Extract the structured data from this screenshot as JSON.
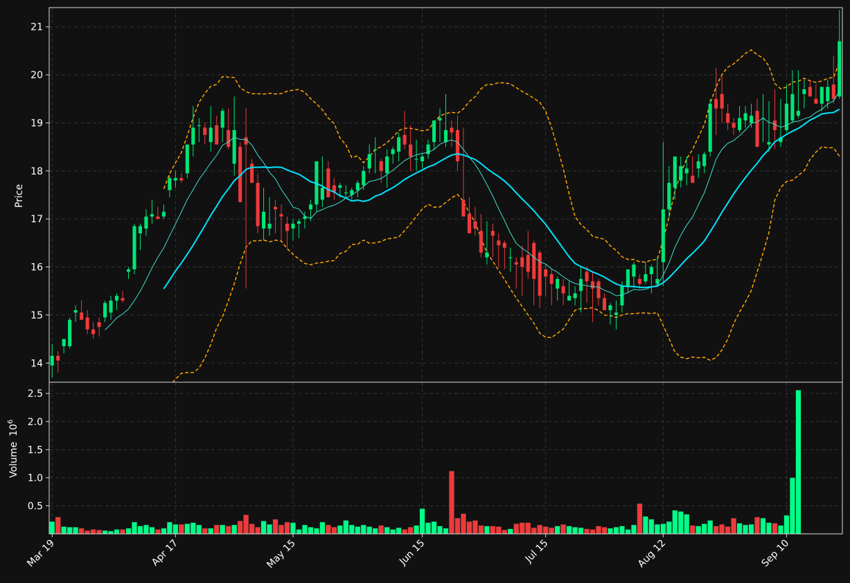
{
  "chart_data": [
    {
      "type": "candlestick",
      "panel": "price",
      "ylabel": "Price",
      "ylim": [
        13.6,
        21.4
      ],
      "yticks": [
        "14",
        "15",
        "16",
        "17",
        "18",
        "19",
        "20",
        "21"
      ],
      "ytick_values": [
        14,
        15,
        16,
        17,
        18,
        19,
        20,
        21
      ],
      "grid": true,
      "overlays": [
        {
          "style": "thin cyan line",
          "color": "#40e0d0",
          "description": "short moving average"
        },
        {
          "style": "thick cyan line",
          "color": "#00e5ff",
          "description": "long moving average"
        },
        {
          "style": "dashed orange lines",
          "color": "#ffa500",
          "description": "upper and lower bands"
        }
      ],
      "colors": {
        "up": "#00e676",
        "down": "#ef3a3a"
      },
      "x_dates": [
        "2024-03-19",
        "2024-03-20",
        "2024-03-21",
        "2024-03-22",
        "2024-03-25",
        "2024-03-26",
        "2024-03-27",
        "2024-03-28",
        "2024-03-29",
        "2024-04-01",
        "2024-04-02",
        "2024-04-03",
        "2024-04-04",
        "2024-04-05",
        "2024-04-08",
        "2024-04-09",
        "2024-04-10",
        "2024-04-11",
        "2024-04-12",
        "2024-04-15",
        "2024-04-16",
        "2024-04-17",
        "2024-04-18",
        "2024-04-19",
        "2024-04-22",
        "2024-04-23",
        "2024-04-24",
        "2024-04-25",
        "2024-04-26",
        "2024-04-29",
        "2024-04-30",
        "2024-05-01",
        "2024-05-02",
        "2024-05-03",
        "2024-05-06",
        "2024-05-07",
        "2024-05-08",
        "2024-05-09",
        "2024-05-10",
        "2024-05-13",
        "2024-05-14",
        "2024-05-15",
        "2024-05-16",
        "2024-05-17",
        "2024-05-20",
        "2024-05-21",
        "2024-05-22",
        "2024-05-23",
        "2024-05-24",
        "2024-05-27",
        "2024-05-28",
        "2024-05-29",
        "2024-05-30",
        "2024-05-31",
        "2024-06-03",
        "2024-06-04",
        "2024-06-05",
        "2024-06-06",
        "2024-06-07",
        "2024-06-10",
        "2024-06-11",
        "2024-06-12",
        "2024-06-13",
        "2024-06-14",
        "2024-06-17",
        "2024-06-18",
        "2024-06-19",
        "2024-06-20",
        "2024-06-21",
        "2024-06-24",
        "2024-06-25",
        "2024-06-26",
        "2024-06-27",
        "2024-06-28",
        "2024-07-01",
        "2024-07-02",
        "2024-07-03",
        "2024-07-04",
        "2024-07-05",
        "2024-07-08",
        "2024-07-09",
        "2024-07-10",
        "2024-07-11",
        "2024-07-12",
        "2024-07-15",
        "2024-07-16",
        "2024-07-17",
        "2024-07-18",
        "2024-07-19",
        "2024-07-22",
        "2024-07-23",
        "2024-07-24",
        "2024-07-25",
        "2024-07-26",
        "2024-07-29",
        "2024-07-30",
        "2024-07-31",
        "2024-08-01",
        "2024-08-02",
        "2024-08-05",
        "2024-08-06",
        "2024-08-07",
        "2024-08-08",
        "2024-08-09",
        "2024-08-12",
        "2024-08-13",
        "2024-08-14",
        "2024-08-15",
        "2024-08-16",
        "2024-08-19",
        "2024-08-20",
        "2024-08-21",
        "2024-08-22",
        "2024-08-23",
        "2024-08-26",
        "2024-08-27",
        "2024-08-28",
        "2024-08-29",
        "2024-08-30",
        "2024-09-02",
        "2024-09-03",
        "2024-09-04",
        "2024-09-05",
        "2024-09-06",
        "2024-09-09",
        "2024-09-10",
        "2024-09-11",
        "2024-09-12",
        "2024-09-13",
        "2024-09-16",
        "2024-09-17",
        "2024-09-18",
        "2024-09-19"
      ],
      "open": [
        13.95,
        14.15,
        14.35,
        14.35,
        15.05,
        15.05,
        14.95,
        14.7,
        14.85,
        14.95,
        15.05,
        15.3,
        15.35,
        15.9,
        15.95,
        16.7,
        16.8,
        17.05,
        17.05,
        17.05,
        17.6,
        17.8,
        17.85,
        17.95,
        18.55,
        18.95,
        18.9,
        18.6,
        18.95,
        18.9,
        18.85,
        18.15,
        18.5,
        18.7,
        18.15,
        17.75,
        16.8,
        16.8,
        17.25,
        17.1,
        16.9,
        16.8,
        16.9,
        17.0,
        17.2,
        17.3,
        17.4,
        18.05,
        17.7,
        17.65,
        17.55,
        17.5,
        17.6,
        17.7,
        18.05,
        18.45,
        18.2,
        17.95,
        18.35,
        18.4,
        18.75,
        18.55,
        18.25,
        18.2,
        18.35,
        18.6,
        19.05,
        18.6,
        18.9,
        18.85,
        17.4,
        17.1,
        16.95,
        16.75,
        16.2,
        16.75,
        16.55,
        16.5,
        16.2,
        16.1,
        16.2,
        16.25,
        16.5,
        16.3,
        15.95,
        15.85,
        15.55,
        15.6,
        15.3,
        15.35,
        15.5,
        15.9,
        15.7,
        15.7,
        15.35,
        15.1,
        15.0,
        15.2,
        15.6,
        15.8,
        15.75,
        15.7,
        15.85,
        15.65,
        16.1,
        17.2,
        17.65,
        17.8,
        17.95,
        17.9,
        18.05,
        18.1,
        18.4,
        19.5,
        19.6,
        19.2,
        19.0,
        18.85,
        19.05,
        19.0,
        19.25,
        19.1,
        18.55,
        19.05,
        18.6,
        18.85,
        19.05,
        19.15,
        19.6,
        19.75,
        19.5,
        19.4,
        19.45,
        19.8,
        19.55,
        20.65
      ],
      "high": [
        14.4,
        14.25,
        14.5,
        14.95,
        15.2,
        15.3,
        15.1,
        14.85,
        14.95,
        15.3,
        15.4,
        15.45,
        15.5,
        16.0,
        16.9,
        16.9,
        17.2,
        17.4,
        17.25,
        17.3,
        17.9,
        18.0,
        17.95,
        18.1,
        19.35,
        19.1,
        19.0,
        19.35,
        19.15,
        19.3,
        19.3,
        19.55,
        18.6,
        19.3,
        18.25,
        17.95,
        17.65,
        17.45,
        17.4,
        17.3,
        17.05,
        17.0,
        17.0,
        17.15,
        17.4,
        17.35,
        18.3,
        18.2,
        17.85,
        17.75,
        17.7,
        17.65,
        17.8,
        18.1,
        18.55,
        18.7,
        18.25,
        18.45,
        18.5,
        18.8,
        19.25,
        18.95,
        18.65,
        18.35,
        18.65,
        18.95,
        19.3,
        19.6,
        19.05,
        19.15,
        18.9,
        17.45,
        17.25,
        17.1,
        16.95,
        16.9,
        16.7,
        16.55,
        16.4,
        16.2,
        16.45,
        16.75,
        16.55,
        16.35,
        16.05,
        15.95,
        15.8,
        15.75,
        15.7,
        15.6,
        16.0,
        16.0,
        15.9,
        15.75,
        15.45,
        15.25,
        15.3,
        15.7,
        15.9,
        16.1,
        15.85,
        16.1,
        16.05,
        16.2,
        18.6,
        18.1,
        18.25,
        18.3,
        18.3,
        18.3,
        18.35,
        18.4,
        19.5,
        20.15,
        20.0,
        19.4,
        19.1,
        19.35,
        19.35,
        19.4,
        19.5,
        19.6,
        19.45,
        19.7,
        19.5,
        19.8,
        20.1,
        20.1,
        19.9,
        19.9,
        19.8,
        19.7,
        19.9,
        20.4,
        21.35
      ],
      "low": [
        13.7,
        13.8,
        14.2,
        14.3,
        14.85,
        14.9,
        14.6,
        14.5,
        14.55,
        14.85,
        14.9,
        15.1,
        15.25,
        15.75,
        15.85,
        16.35,
        16.65,
        16.9,
        17.0,
        17.0,
        17.45,
        17.65,
        17.75,
        17.85,
        18.3,
        18.6,
        18.55,
        18.4,
        18.75,
        18.6,
        18.45,
        17.9,
        17.8,
        15.55,
        17.8,
        16.7,
        16.55,
        16.65,
        16.7,
        16.55,
        16.4,
        16.55,
        16.6,
        16.8,
        16.95,
        17.15,
        17.25,
        17.45,
        17.4,
        17.45,
        17.45,
        17.4,
        17.45,
        17.6,
        17.95,
        17.95,
        17.75,
        17.65,
        18.15,
        18.2,
        18.45,
        18.0,
        18.0,
        18.05,
        18.25,
        18.45,
        18.6,
        18.5,
        18.5,
        18.0,
        17.25,
        16.9,
        16.65,
        16.2,
        16.05,
        16.2,
        16.0,
        15.95,
        15.9,
        15.55,
        15.4,
        15.75,
        15.2,
        15.15,
        15.4,
        15.2,
        15.3,
        15.2,
        15.3,
        15.2,
        15.05,
        15.25,
        14.85,
        15.2,
        15.2,
        14.8,
        14.7,
        15.05,
        15.45,
        15.55,
        15.55,
        15.65,
        15.45,
        15.6,
        15.6,
        17.0,
        17.4,
        17.65,
        17.7,
        17.8,
        17.85,
        17.95,
        18.3,
        18.75,
        19.0,
        18.85,
        18.75,
        18.8,
        18.9,
        18.9,
        18.6,
        18.6,
        18.4,
        18.45,
        18.5,
        18.8,
        19.0,
        19.1,
        19.3,
        19.55,
        19.4,
        19.25,
        19.3,
        19.4,
        19.5
      ],
      "close": [
        14.15,
        14.05,
        14.5,
        14.9,
        15.1,
        14.9,
        14.7,
        14.6,
        14.75,
        15.25,
        15.3,
        15.4,
        15.3,
        15.95,
        16.85,
        16.85,
        17.05,
        17.1,
        17.0,
        17.15,
        17.85,
        17.85,
        17.8,
        18.55,
        18.9,
        18.95,
        18.75,
        18.9,
        18.55,
        19.25,
        18.5,
        18.85,
        17.35,
        18.55,
        17.75,
        16.85,
        17.15,
        16.9,
        17.2,
        17.05,
        16.75,
        16.9,
        16.95,
        17.05,
        17.3,
        18.2,
        17.65,
        17.45,
        17.55,
        17.7,
        17.55,
        17.6,
        17.75,
        18.0,
        18.35,
        18.45,
        18.0,
        18.3,
        18.45,
        18.7,
        18.55,
        18.3,
        18.25,
        18.3,
        18.55,
        19.05,
        19.1,
        18.85,
        18.8,
        18.2,
        17.05,
        16.7,
        16.8,
        16.3,
        16.3,
        16.65,
        16.45,
        16.4,
        16.2,
        16.05,
        16.0,
        15.9,
        15.75,
        15.4,
        15.8,
        15.65,
        15.75,
        15.45,
        15.4,
        15.45,
        15.75,
        15.7,
        15.55,
        15.35,
        15.1,
        15.2,
        15.05,
        15.6,
        15.95,
        16.05,
        15.65,
        15.85,
        16.0,
        15.75,
        17.2,
        17.75,
        18.3,
        18.1,
        18.05,
        17.75,
        18.2,
        18.35,
        19.4,
        19.3,
        19.3,
        19.0,
        18.9,
        19.1,
        19.2,
        19.15,
        18.5,
        19.1,
        18.6,
        18.85,
        18.7,
        19.4,
        19.6,
        19.25,
        19.7,
        19.55,
        19.4,
        19.75,
        19.75,
        19.5,
        20.7
      ]
    },
    {
      "type": "bar",
      "panel": "volume",
      "ylabel": "Volume",
      "ylabel_multiplier": "10",
      "ylabel_exponent": "6",
      "ylim": [
        0,
        2.7
      ],
      "yticks": [
        "0.5",
        "1.0",
        "1.5",
        "2.0",
        "2.5"
      ],
      "ytick_values": [
        0.5,
        1.0,
        1.5,
        2.0,
        2.5
      ],
      "grid": true,
      "values": [
        0.22,
        0.3,
        0.13,
        0.12,
        0.12,
        0.1,
        0.06,
        0.08,
        0.07,
        0.06,
        0.05,
        0.08,
        0.08,
        0.1,
        0.21,
        0.14,
        0.16,
        0.12,
        0.08,
        0.1,
        0.21,
        0.17,
        0.17,
        0.18,
        0.2,
        0.16,
        0.1,
        0.1,
        0.16,
        0.16,
        0.14,
        0.16,
        0.23,
        0.34,
        0.18,
        0.12,
        0.23,
        0.17,
        0.26,
        0.16,
        0.21,
        0.2,
        0.08,
        0.16,
        0.12,
        0.1,
        0.21,
        0.16,
        0.12,
        0.15,
        0.24,
        0.16,
        0.13,
        0.16,
        0.13,
        0.1,
        0.15,
        0.12,
        0.08,
        0.11,
        0.08,
        0.12,
        0.15,
        0.45,
        0.2,
        0.22,
        0.14,
        0.1,
        1.12,
        0.28,
        0.36,
        0.22,
        0.24,
        0.15,
        0.14,
        0.14,
        0.13,
        0.07,
        0.09,
        0.18,
        0.2,
        0.2,
        0.11,
        0.16,
        0.13,
        0.11,
        0.14,
        0.17,
        0.14,
        0.12,
        0.11,
        0.09,
        0.08,
        0.14,
        0.12,
        0.1,
        0.12,
        0.14,
        0.08,
        0.16,
        0.54,
        0.31,
        0.26,
        0.17,
        0.18,
        0.22,
        0.42,
        0.4,
        0.35,
        0.15,
        0.14,
        0.18,
        0.24,
        0.14,
        0.17,
        0.13,
        0.28,
        0.19,
        0.16,
        0.17,
        0.3,
        0.28,
        0.2,
        0.19,
        0.15,
        0.33,
        1.0,
        2.56
      ]
    }
  ],
  "x_axis": {
    "tick_labels": [
      "Mar 19",
      "Apr 17",
      "May 15",
      "Jun 15",
      "Jul 15",
      "Aug 12",
      "Sep 10"
    ],
    "tick_dates": [
      "2024-03-19",
      "2024-04-17",
      "2024-05-15",
      "2024-06-14",
      "2024-07-15",
      "2024-08-12",
      "2024-09-10"
    ]
  },
  "colors": {
    "background": "#111111",
    "grid": "#333333",
    "axes": "#dddddd",
    "text": "#ffffff",
    "up": "#00e676",
    "down": "#ef3a3a",
    "volume_up": "#00ff88",
    "volume_down": "#ef3a3a",
    "ma_short": "#40e0d0",
    "ma_long": "#00e5ff",
    "bands": "#ffa500"
  }
}
